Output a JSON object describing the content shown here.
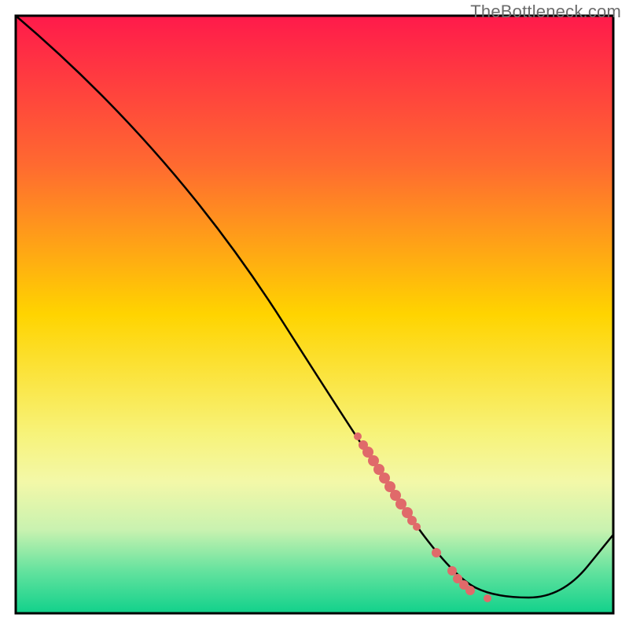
{
  "watermark": "TheBottleneck.com",
  "chart_data": {
    "type": "line",
    "title": "",
    "xlabel": "",
    "ylabel": "",
    "xlim": [
      20,
      780
    ],
    "ylim": [
      20,
      780
    ],
    "gradient_stops": [
      {
        "offset": 0.0,
        "color": "#ff1a4b"
      },
      {
        "offset": 0.25,
        "color": "#ff6a30"
      },
      {
        "offset": 0.5,
        "color": "#ffd400"
      },
      {
        "offset": 0.7,
        "color": "#f7f37a"
      },
      {
        "offset": 0.78,
        "color": "#f3f8a8"
      },
      {
        "offset": 0.86,
        "color": "#c9f2b0"
      },
      {
        "offset": 0.93,
        "color": "#63e29e"
      },
      {
        "offset": 1.0,
        "color": "#11d18b"
      }
    ],
    "line_points": [
      {
        "x": 20,
        "y": 20
      },
      {
        "x": 220,
        "y": 190
      },
      {
        "x": 500,
        "y": 630
      },
      {
        "x": 580,
        "y": 735
      },
      {
        "x": 630,
        "y": 760
      },
      {
        "x": 715,
        "y": 760
      },
      {
        "x": 780,
        "y": 680
      }
    ],
    "scatter_points": [
      {
        "x": 455,
        "y": 555,
        "r": 5
      },
      {
        "x": 462,
        "y": 566,
        "r": 6
      },
      {
        "x": 468,
        "y": 575,
        "r": 7
      },
      {
        "x": 475,
        "y": 586,
        "r": 7
      },
      {
        "x": 482,
        "y": 597,
        "r": 7
      },
      {
        "x": 489,
        "y": 608,
        "r": 7
      },
      {
        "x": 496,
        "y": 619,
        "r": 7
      },
      {
        "x": 503,
        "y": 630,
        "r": 7
      },
      {
        "x": 510,
        "y": 641,
        "r": 7
      },
      {
        "x": 518,
        "y": 652,
        "r": 7
      },
      {
        "x": 524,
        "y": 662,
        "r": 6
      },
      {
        "x": 530,
        "y": 670,
        "r": 5
      },
      {
        "x": 555,
        "y": 703,
        "r": 6
      },
      {
        "x": 575,
        "y": 726,
        "r": 6
      },
      {
        "x": 582,
        "y": 736,
        "r": 6
      },
      {
        "x": 590,
        "y": 744,
        "r": 6
      },
      {
        "x": 598,
        "y": 751,
        "r": 6
      },
      {
        "x": 620,
        "y": 761,
        "r": 5
      }
    ],
    "scatter_color": "#e06a6a"
  }
}
